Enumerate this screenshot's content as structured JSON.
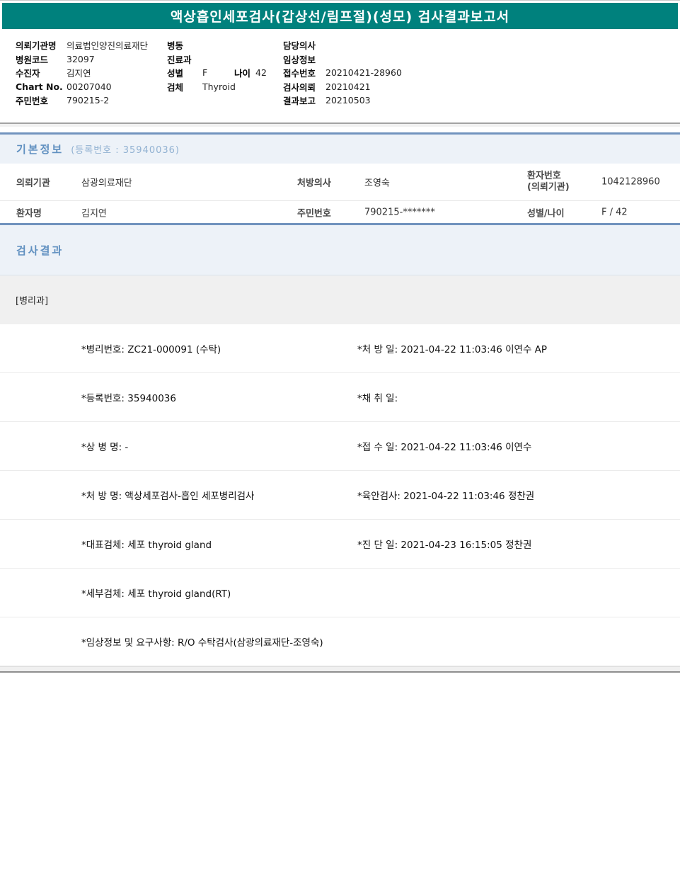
{
  "title": "액상흡인세포검사(갑상선/림프절)(성모) 검사결과보고서",
  "colors": {
    "title_bar": "#00817d",
    "section_accent": "#7193be",
    "section_bg": "#edf2f8",
    "section_text": "#6090c0"
  },
  "header": {
    "left_rows": [
      {
        "label": "의뢰기관명",
        "value": "의료법인양진의료재단"
      },
      {
        "label": "병원코드",
        "value": "32097"
      },
      {
        "label": "수진자",
        "value": "김지연"
      },
      {
        "label": "Chart No.",
        "value": "00207040"
      },
      {
        "label": "주민번호",
        "value": "790215-2"
      }
    ],
    "middle_rows": [
      {
        "label": "병동",
        "value": ""
      },
      {
        "label": "진료과",
        "value": ""
      },
      {
        "label": "성별",
        "value": "F",
        "label2": "나이",
        "value2": "42"
      },
      {
        "label": "검체",
        "value": "Thyroid"
      }
    ],
    "right_rows": [
      {
        "label": "담당의사",
        "value": ""
      },
      {
        "label": "임상정보",
        "value": ""
      },
      {
        "label": "접수번호",
        "value": "20210421-28960"
      },
      {
        "label": "검사의뢰",
        "value": "20210421"
      },
      {
        "label": "결과보고",
        "value": "20210503"
      }
    ]
  },
  "basic_info": {
    "title": "기본정보",
    "reg_label": "(등록번호 : 35940036)",
    "table": {
      "row1": {
        "c1_label": "의뢰기관",
        "c1_value": "삼광의료재단",
        "c2_label": "처방의사",
        "c2_value": "조영숙",
        "c3_label_line1": "환자번호",
        "c3_label_line2": "(의뢰기관)",
        "c3_value": "1042128960"
      },
      "row2": {
        "c1_label": "환자명",
        "c1_value": "김지연",
        "c2_label": "주민번호",
        "c2_value": "790215-*******",
        "c3_label": "성별/나이",
        "c3_value": "F / 42"
      }
    }
  },
  "results": {
    "title": "검사결과",
    "department": "[병리과]",
    "rows": [
      {
        "left": "*병리번호: ZC21-000091 (수탁)",
        "right": "*처 방 일: 2021-04-22 11:03:46  이연수 AP"
      },
      {
        "left": "*등록번호: 35940036",
        "right": "*채 취 일:"
      },
      {
        "left": "*상 병 명: -",
        "right": "*접 수 일: 2021-04-22 11:03:46  이연수"
      },
      {
        "left": "*처 방 명: 액상세포검사-흡인 세포병리검사",
        "right": "*육안검사: 2021-04-22 11:03:46  정찬권"
      },
      {
        "left": "*대표검체: 세포 thyroid gland",
        "right": "*진 단 일: 2021-04-23 16:15:05  정찬권"
      },
      {
        "left": "*세부검체: 세포 thyroid gland(RT)",
        "right": ""
      },
      {
        "left": "*임상정보 및 요구사항: R/O 수탁검사(삼광의료재단-조영숙)",
        "right": ""
      }
    ]
  }
}
